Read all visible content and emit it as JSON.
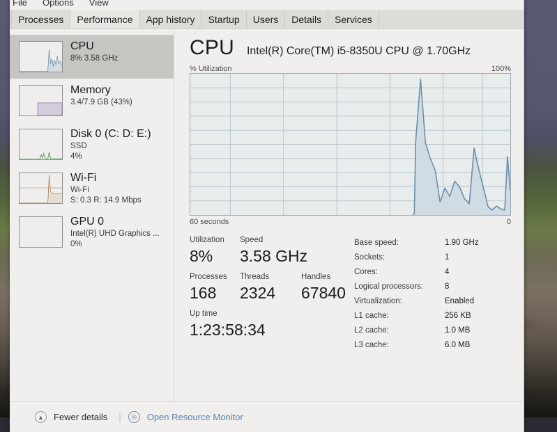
{
  "menubar": {
    "items": [
      {
        "label": "File"
      },
      {
        "label": "Options"
      },
      {
        "label": "View"
      }
    ]
  },
  "tabs": [
    {
      "label": "Processes",
      "active": false
    },
    {
      "label": "Performance",
      "active": true
    },
    {
      "label": "App history",
      "active": false
    },
    {
      "label": "Startup",
      "active": false
    },
    {
      "label": "Users",
      "active": false
    },
    {
      "label": "Details",
      "active": false
    },
    {
      "label": "Services",
      "active": false
    }
  ],
  "sidebar": {
    "items": [
      {
        "title": "CPU",
        "sub1": "8%  3.58 GHz",
        "sub2": "",
        "selected": true,
        "color": "#5e7f9e"
      },
      {
        "title": "Memory",
        "sub1": "3.4/7.9 GB (43%)",
        "sub2": "",
        "selected": false,
        "color": "#8b6fa8"
      },
      {
        "title": "Disk 0 (C: D: E:)",
        "sub1": "SSD",
        "sub2": "4%",
        "selected": false,
        "color": "#5f9e63"
      },
      {
        "title": "Wi-Fi",
        "sub1": "Wi-Fi",
        "sub2": "S: 0.3 R: 14.9 Mbps",
        "selected": false,
        "color": "#b08a5a"
      },
      {
        "title": "GPU 0",
        "sub1": "Intel(R) UHD Graphics ...",
        "sub2": "0%",
        "selected": false,
        "color": "#5e7f9e"
      }
    ]
  },
  "main": {
    "title": "CPU",
    "model": "Intel(R) Core(TM) i5-8350U CPU @ 1.70GHz",
    "graph_axis_label": "% Utilization",
    "graph_max_label": "100%",
    "graph_time_left": "60 seconds",
    "graph_time_right": "0"
  },
  "chart_data": {
    "type": "line",
    "title": "% Utilization",
    "xlabel": "seconds",
    "ylabel": "% Utilization",
    "ylim": [
      0,
      100
    ],
    "xlim": [
      60,
      0
    ],
    "x_tick_labels": [
      "60 seconds",
      "0"
    ],
    "y_tick_labels": [
      "100%"
    ],
    "grid": true,
    "line_color": "#6b8fa8",
    "fill_color": "#cdd8e0",
    "series": [
      {
        "name": "CPU utilization",
        "x": [
          26,
          25,
          24,
          23,
          22,
          21,
          20,
          19,
          18,
          17,
          16,
          15,
          14,
          13,
          12,
          11,
          10,
          9,
          8,
          7,
          6,
          5,
          4,
          3,
          2,
          1,
          0
        ],
        "values": [
          0,
          1,
          52,
          85,
          38,
          30,
          22,
          9,
          19,
          13,
          24,
          20,
          12,
          8,
          40,
          24,
          12,
          4,
          3,
          6,
          4,
          3,
          6,
          36,
          20,
          10,
          8
        ]
      }
    ]
  },
  "stats": {
    "left": [
      {
        "label": "Utilization",
        "value": "8%"
      },
      {
        "label": "Speed",
        "value": "3.58 GHz"
      },
      {
        "label": "Processes",
        "value": "168"
      },
      {
        "label": "Threads",
        "value": "2324"
      },
      {
        "label": "Handles",
        "value": "67840"
      },
      {
        "label": "Up time",
        "value": "1:23:58:34"
      }
    ],
    "right": [
      {
        "key": "Base speed:",
        "value": "1.90 GHz"
      },
      {
        "key": "Sockets:",
        "value": "1"
      },
      {
        "key": "Cores:",
        "value": "4"
      },
      {
        "key": "Logical processors:",
        "value": "8"
      },
      {
        "key": "Virtualization:",
        "value": "Enabled"
      },
      {
        "key": "L1 cache:",
        "value": "256 KB"
      },
      {
        "key": "L2 cache:",
        "value": "1.0 MB"
      },
      {
        "key": "L3 cache:",
        "value": "6.0 MB"
      }
    ]
  },
  "footer": {
    "fewer_details": "Fewer details",
    "separator": "|",
    "open_resource_monitor": "Open Resource Monitor"
  }
}
